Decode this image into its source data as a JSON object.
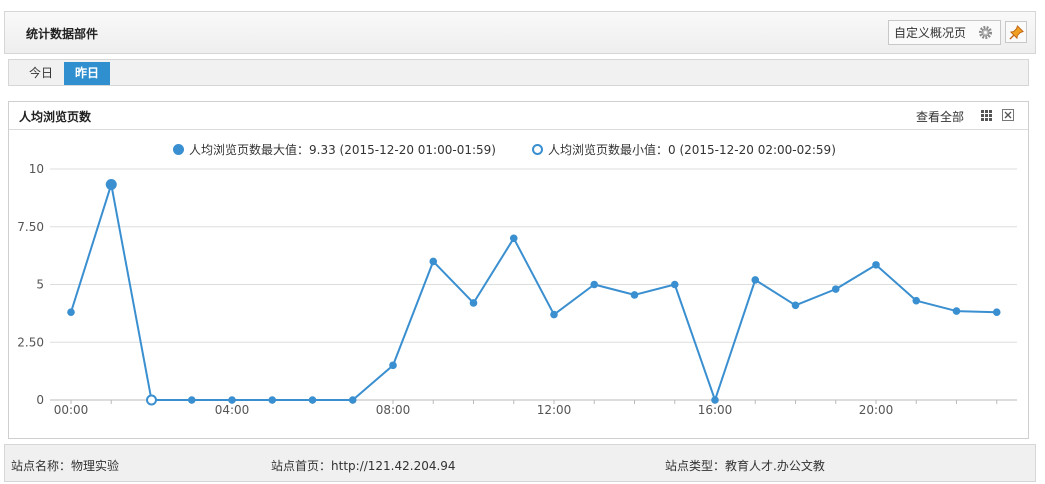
{
  "header": {
    "title": "统计数据部件",
    "custom_button_label": "自定义概况页"
  },
  "tabs": [
    {
      "label": "今日",
      "active": false
    },
    {
      "label": "昨日",
      "active": true
    }
  ],
  "panel": {
    "title": "人均浏览页数",
    "view_all_label": "查看全部"
  },
  "legend": {
    "max_label": "人均浏览页数最大值：",
    "max_value": "9.33 (2015-12-20 01:00-01:59)",
    "min_label": "人均浏览页数最小值：",
    "min_value": "0 (2015-12-20 02:00-02:59)"
  },
  "footer": {
    "site_name_label": "站点名称：",
    "site_name": "物理实验",
    "homepage_label": "站点首页：",
    "homepage": "http://121.42.204.94",
    "site_type_label": "站点类型：",
    "site_type": "教育人才.办公文教"
  },
  "colors": {
    "accent": "#2f8fcf",
    "line": "#3a8fd0"
  },
  "chart_data": {
    "type": "line",
    "x": [
      "00:00",
      "01:00",
      "02:00",
      "03:00",
      "04:00",
      "05:00",
      "06:00",
      "07:00",
      "08:00",
      "09:00",
      "10:00",
      "11:00",
      "12:00",
      "13:00",
      "14:00",
      "15:00",
      "16:00",
      "17:00",
      "18:00",
      "19:00",
      "20:00",
      "21:00",
      "22:00",
      "23:00"
    ],
    "x_tick_labels": [
      "00:00",
      "04:00",
      "08:00",
      "12:00",
      "16:00",
      "20:00"
    ],
    "series": [
      {
        "name": "人均浏览页数",
        "values": [
          3.8,
          9.33,
          0,
          0,
          0,
          0,
          0,
          0,
          1.5,
          6.0,
          4.2,
          7.0,
          3.7,
          5.0,
          4.55,
          5.0,
          0,
          5.2,
          4.1,
          4.8,
          5.85,
          4.3,
          3.85,
          3.8
        ]
      }
    ],
    "y_ticks": [
      "10",
      "7.50",
      "5",
      "2.50",
      "0"
    ],
    "ylim": [
      0,
      10
    ],
    "max_index": 1,
    "min_index": 2,
    "grid": true
  }
}
